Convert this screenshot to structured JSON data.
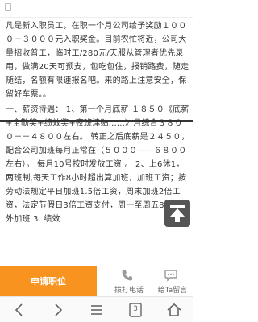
{
  "article": {
    "paragraph1": "凡是新入职员工，在职一个月公司给予奖励１０００－３０００元入职奖金。目前农忙将近，公司大量招收普工，临时工/280元/天服从管理者优先录用，做满20天可预支，包吃包住，报销路费，随走随结，名额有限速报名吧。来的路上注意安全，保留好车票。。",
    "paragraph2": "一、薪资待遇：  1、第一个月底薪 １８５０《底薪+全勤奖+绩效奖+夜班津贴......》月综合３８００－－４８００左右。 转正之后底薪是２４５０，配合公司加班每月正常在（５０００——６８００左右）。 每月10号按时发放工资 。 2、上6休1，两班制,每天工作8小时超出算加班，加班工资；按劳动法规定平日加班1.5倍工资，周末加班2倍工资，法定节假日3倍工资支付，周一至周五8小时之外加班 3. 绩效"
  },
  "actions": {
    "apply_label": "申请职位",
    "call_label": "拨打电话",
    "chat_label": "给Ta留言"
  },
  "nav": {
    "tab_count": "3"
  },
  "colors": {
    "accent": "#f7931e",
    "float_button": "#555555"
  },
  "icons": [
    "back-to-top-icon",
    "phone-icon",
    "chat-icon",
    "back-icon",
    "forward-icon",
    "menu-icon",
    "tabs-icon",
    "home-icon"
  ]
}
